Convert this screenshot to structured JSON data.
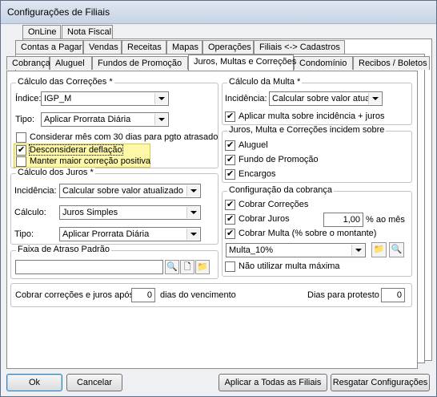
{
  "window": {
    "title": "Configurações de Filiais"
  },
  "tabs_row1": [
    "OnLine",
    "Nota Fiscal"
  ],
  "tabs_row2": [
    "Contas a Pagar",
    "Vendas",
    "Receitas",
    "Mapas",
    "Operações",
    "Filiais <-> Cadastros"
  ],
  "tabs_row3": [
    "Cobrança",
    "Aluguel",
    "Fundos de Promoção",
    "Juros, Multas e Correções",
    "Condomínio",
    "Recibos / Boletos"
  ],
  "correcoes": {
    "legend": "Cálculo das Correções *",
    "indice_label": "Índice:",
    "indice_value": "IGP_M",
    "tipo_label": "Tipo:",
    "tipo_value": "Aplicar Prorrata Diária",
    "mes30_label": "Considerar mês com 30 dias para pgto atrasado",
    "deflacao_label": "Desconsiderar deflação",
    "maior_label": "Manter maior correção positiva"
  },
  "juros": {
    "legend": "Cálculo dos Juros *",
    "incidencia_label": "Incidência:",
    "incidencia_value": "Calcular sobre valor atualizado",
    "calculo_label": "Cálculo:",
    "calculo_value": "Juros Simples",
    "tipo_label": "Tipo:",
    "tipo_value": "Aplicar Prorrata Diária"
  },
  "faixa": {
    "legend": "Faixa de Atraso Padrão",
    "value": ""
  },
  "multa": {
    "legend": "Cálculo da Multa *",
    "incidencia_label": "Incidência:",
    "incidencia_value": "Calcular sobre valor atuali",
    "aplicar_label": "Aplicar multa sobre incidência + juros"
  },
  "incidem": {
    "legend": "Juros, Multa e Correções incidem sobre",
    "aluguel": "Aluguel",
    "fundo": "Fundo de Promoção",
    "encargos": "Encargos"
  },
  "cobranca": {
    "legend": "Configuração da cobrança",
    "correcoes": "Cobrar Correções",
    "juros": "Cobrar Juros",
    "juros_value": "1,00",
    "juros_unit": "% ao mês",
    "multa": "Cobrar Multa (% sobre o montante)",
    "multa_value": "Multa_10%",
    "nao_max": "Não utilizar multa máxima"
  },
  "bottom": {
    "cobrar_label": "Cobrar correções e juros após",
    "cobrar_value": "0",
    "dias_label": "dias do vencimento",
    "protesto_label": "Dias para protesto",
    "protesto_value": "0"
  },
  "buttons": {
    "ok": "Ok",
    "cancel": "Cancelar",
    "aplicar": "Aplicar a Todas as Filiais",
    "resgatar": "Resgatar Configurações"
  }
}
